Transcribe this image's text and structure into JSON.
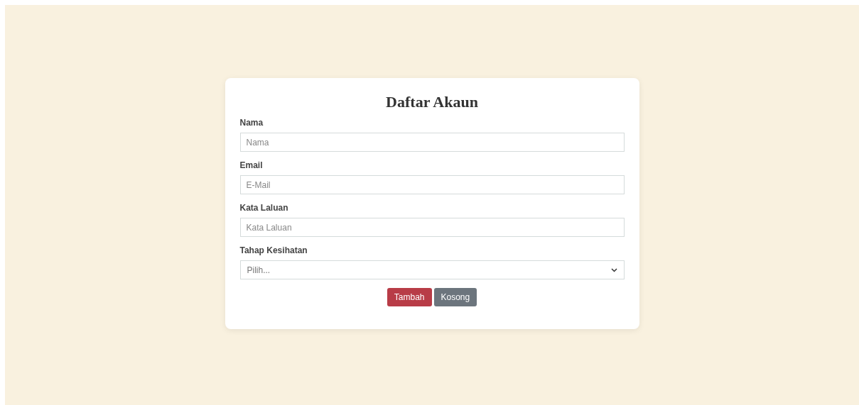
{
  "form": {
    "title": "Daftar Akaun",
    "fields": [
      {
        "kind": "text",
        "label": "Nama",
        "placeholder": "Nama"
      },
      {
        "kind": "text",
        "label": "Email",
        "placeholder": "E-Mail"
      },
      {
        "kind": "text",
        "label": "Kata Laluan",
        "placeholder": "Kata Laluan"
      },
      {
        "kind": "select",
        "label": "Tahap Kesihatan",
        "placeholder": "Pilih..."
      }
    ],
    "buttons": [
      {
        "kind": "danger",
        "label": "Tambah"
      },
      {
        "kind": "secondary",
        "label": "Kosong"
      }
    ]
  }
}
